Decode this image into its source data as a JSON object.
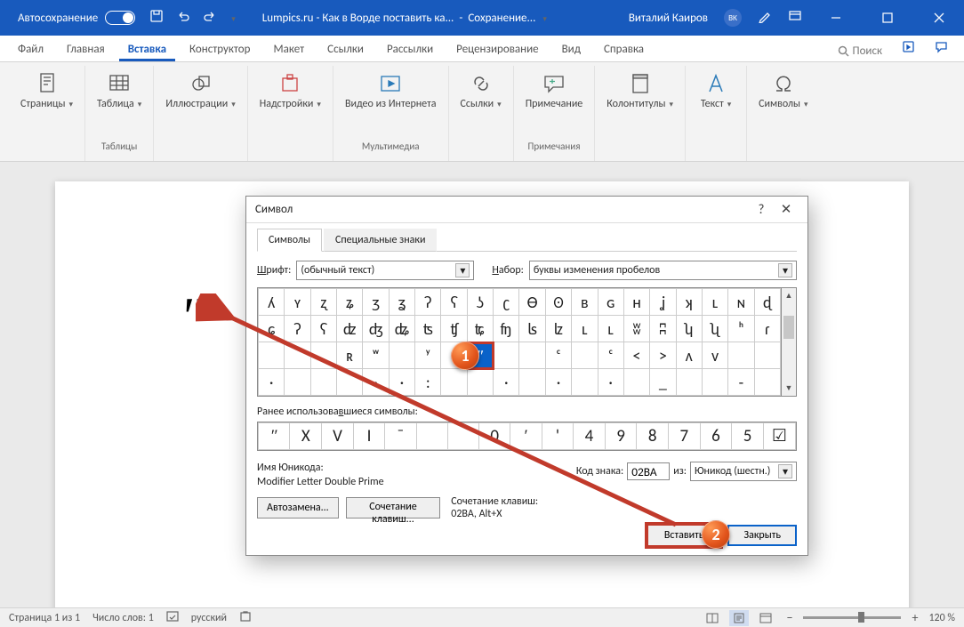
{
  "titlebar": {
    "autosave": "Автосохранение",
    "doc_title": "Lumpics.ru - Как в Ворде поставить ка...",
    "saving": "Сохранение...",
    "user": "Виталий Каиров",
    "user_initials": "ВК"
  },
  "tabs": {
    "file": "Файл",
    "home": "Главная",
    "insert": "Вставка",
    "design": "Конструктор",
    "layout": "Макет",
    "references": "Ссылки",
    "mailings": "Рассылки",
    "review": "Рецензирование",
    "view": "Вид",
    "help": "Справка",
    "search": "Поиск"
  },
  "ribbon": {
    "pages": "Страницы",
    "table": "Таблица",
    "tables_grp": "Таблицы",
    "illustrations": "Иллюстрации",
    "addins": "Надстройки",
    "video": "Видео из Интернета",
    "media_grp": "Мультимедиа",
    "links": "Ссылки",
    "comment": "Примечание",
    "comments_grp": "Примечания",
    "header_footer": "Колонтитулы",
    "text": "Текст",
    "symbols": "Символы"
  },
  "document": {
    "content": "ʺʺ"
  },
  "dialog": {
    "title": "Символ",
    "tab_symbols": "Символы",
    "tab_special": "Специальные знаки",
    "font_label": "Шрифт:",
    "font_value": "(обычный текст)",
    "set_label": "Набор:",
    "set_value": "буквы изменения пробелов",
    "grid": [
      [
        "ʎ",
        "ʏ",
        "ʐ",
        "ʑ",
        "ʒ",
        "ʓ",
        "ʔ",
        "ʕ",
        "ʖ",
        "ʗ",
        "Ɵ",
        "ʘ",
        "ʙ",
        "ɢ",
        "ʜ",
        "ʝ",
        "ʞ",
        "ʟ",
        "ɴ",
        "ɖ"
      ],
      [
        "ɕ",
        "ʡ",
        "ʢ",
        "ʣ",
        "ʤ",
        "ʥ",
        "ʦ",
        "ʧ",
        "ʨ",
        "ʩ",
        "ʪ",
        "ʫ",
        "ʟ",
        "ʟ",
        "ʬ",
        "ʭ",
        "ʮ",
        "ʯ",
        "ʰ",
        "ɾ"
      ],
      [
        "",
        "",
        "",
        "ʀ",
        "ʷ",
        "",
        "ʸ",
        "ʹ",
        "ʺ",
        "",
        "",
        "ᶜ",
        "",
        "ᶜ",
        "<",
        ">",
        "ʌ",
        "v",
        "",
        ""
      ],
      [
        "·",
        "",
        "",
        "",
        "·",
        "·",
        ":",
        "",
        "",
        "·",
        "",
        "·",
        "",
        "·",
        "",
        "_",
        "",
        "",
        "-",
        ""
      ]
    ],
    "selected_row": 2,
    "selected_col": 8,
    "recent_label": "Ранее использовавшиеся символы:",
    "recent": [
      "ʺ",
      "X",
      "V",
      "I",
      "¯",
      "",
      "",
      "0",
      "′",
      "'",
      "4",
      "9",
      "8",
      "7",
      "6",
      "5",
      "☑"
    ],
    "unicode_label": "Имя Юникода:",
    "unicode_name": "Modifier Letter Double Prime",
    "code_label": "Код знака:",
    "code_value": "02BA",
    "from_label": "из:",
    "from_value": "Юникод (шестн.)",
    "autocorrect": "Автозамена...",
    "shortcut": "Сочетание клавиш...",
    "shortcut_text": "Сочетание клавиш: 02BA, Alt+X",
    "insert": "Вставить",
    "close": "Закрыть"
  },
  "callouts": {
    "c1": "1",
    "c2": "2"
  },
  "status": {
    "page": "Страница 1 из 1",
    "words": "Число слов: 1",
    "lang": "русский",
    "zoom": "120 %",
    "minus": "−",
    "plus": "+"
  }
}
